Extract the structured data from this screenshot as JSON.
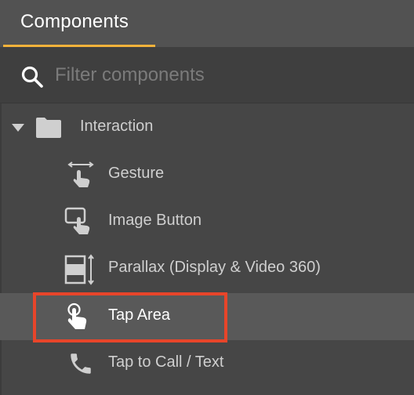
{
  "panel": {
    "tab": {
      "label": "Components"
    },
    "search": {
      "placeholder": "Filter components",
      "value": ""
    },
    "tree": {
      "folder": {
        "label": "Interaction",
        "expanded": true,
        "icon": "folder-icon"
      },
      "items": [
        {
          "label": "Gesture",
          "icon": "swipe-gesture-icon",
          "selected": false
        },
        {
          "label": "Image Button",
          "icon": "image-button-icon",
          "selected": false
        },
        {
          "label": "Parallax (Display & Video 360)",
          "icon": "parallax-icon",
          "selected": false
        },
        {
          "label": "Tap Area",
          "icon": "tap-area-icon",
          "selected": true
        },
        {
          "label": "Tap to Call / Text",
          "icon": "phone-icon",
          "selected": false
        }
      ]
    }
  },
  "colors": {
    "background": "#464646",
    "header": "#525252",
    "tab_underline": "#f3b23a",
    "selected_row": "#595959",
    "highlight_box": "#e8452a"
  }
}
